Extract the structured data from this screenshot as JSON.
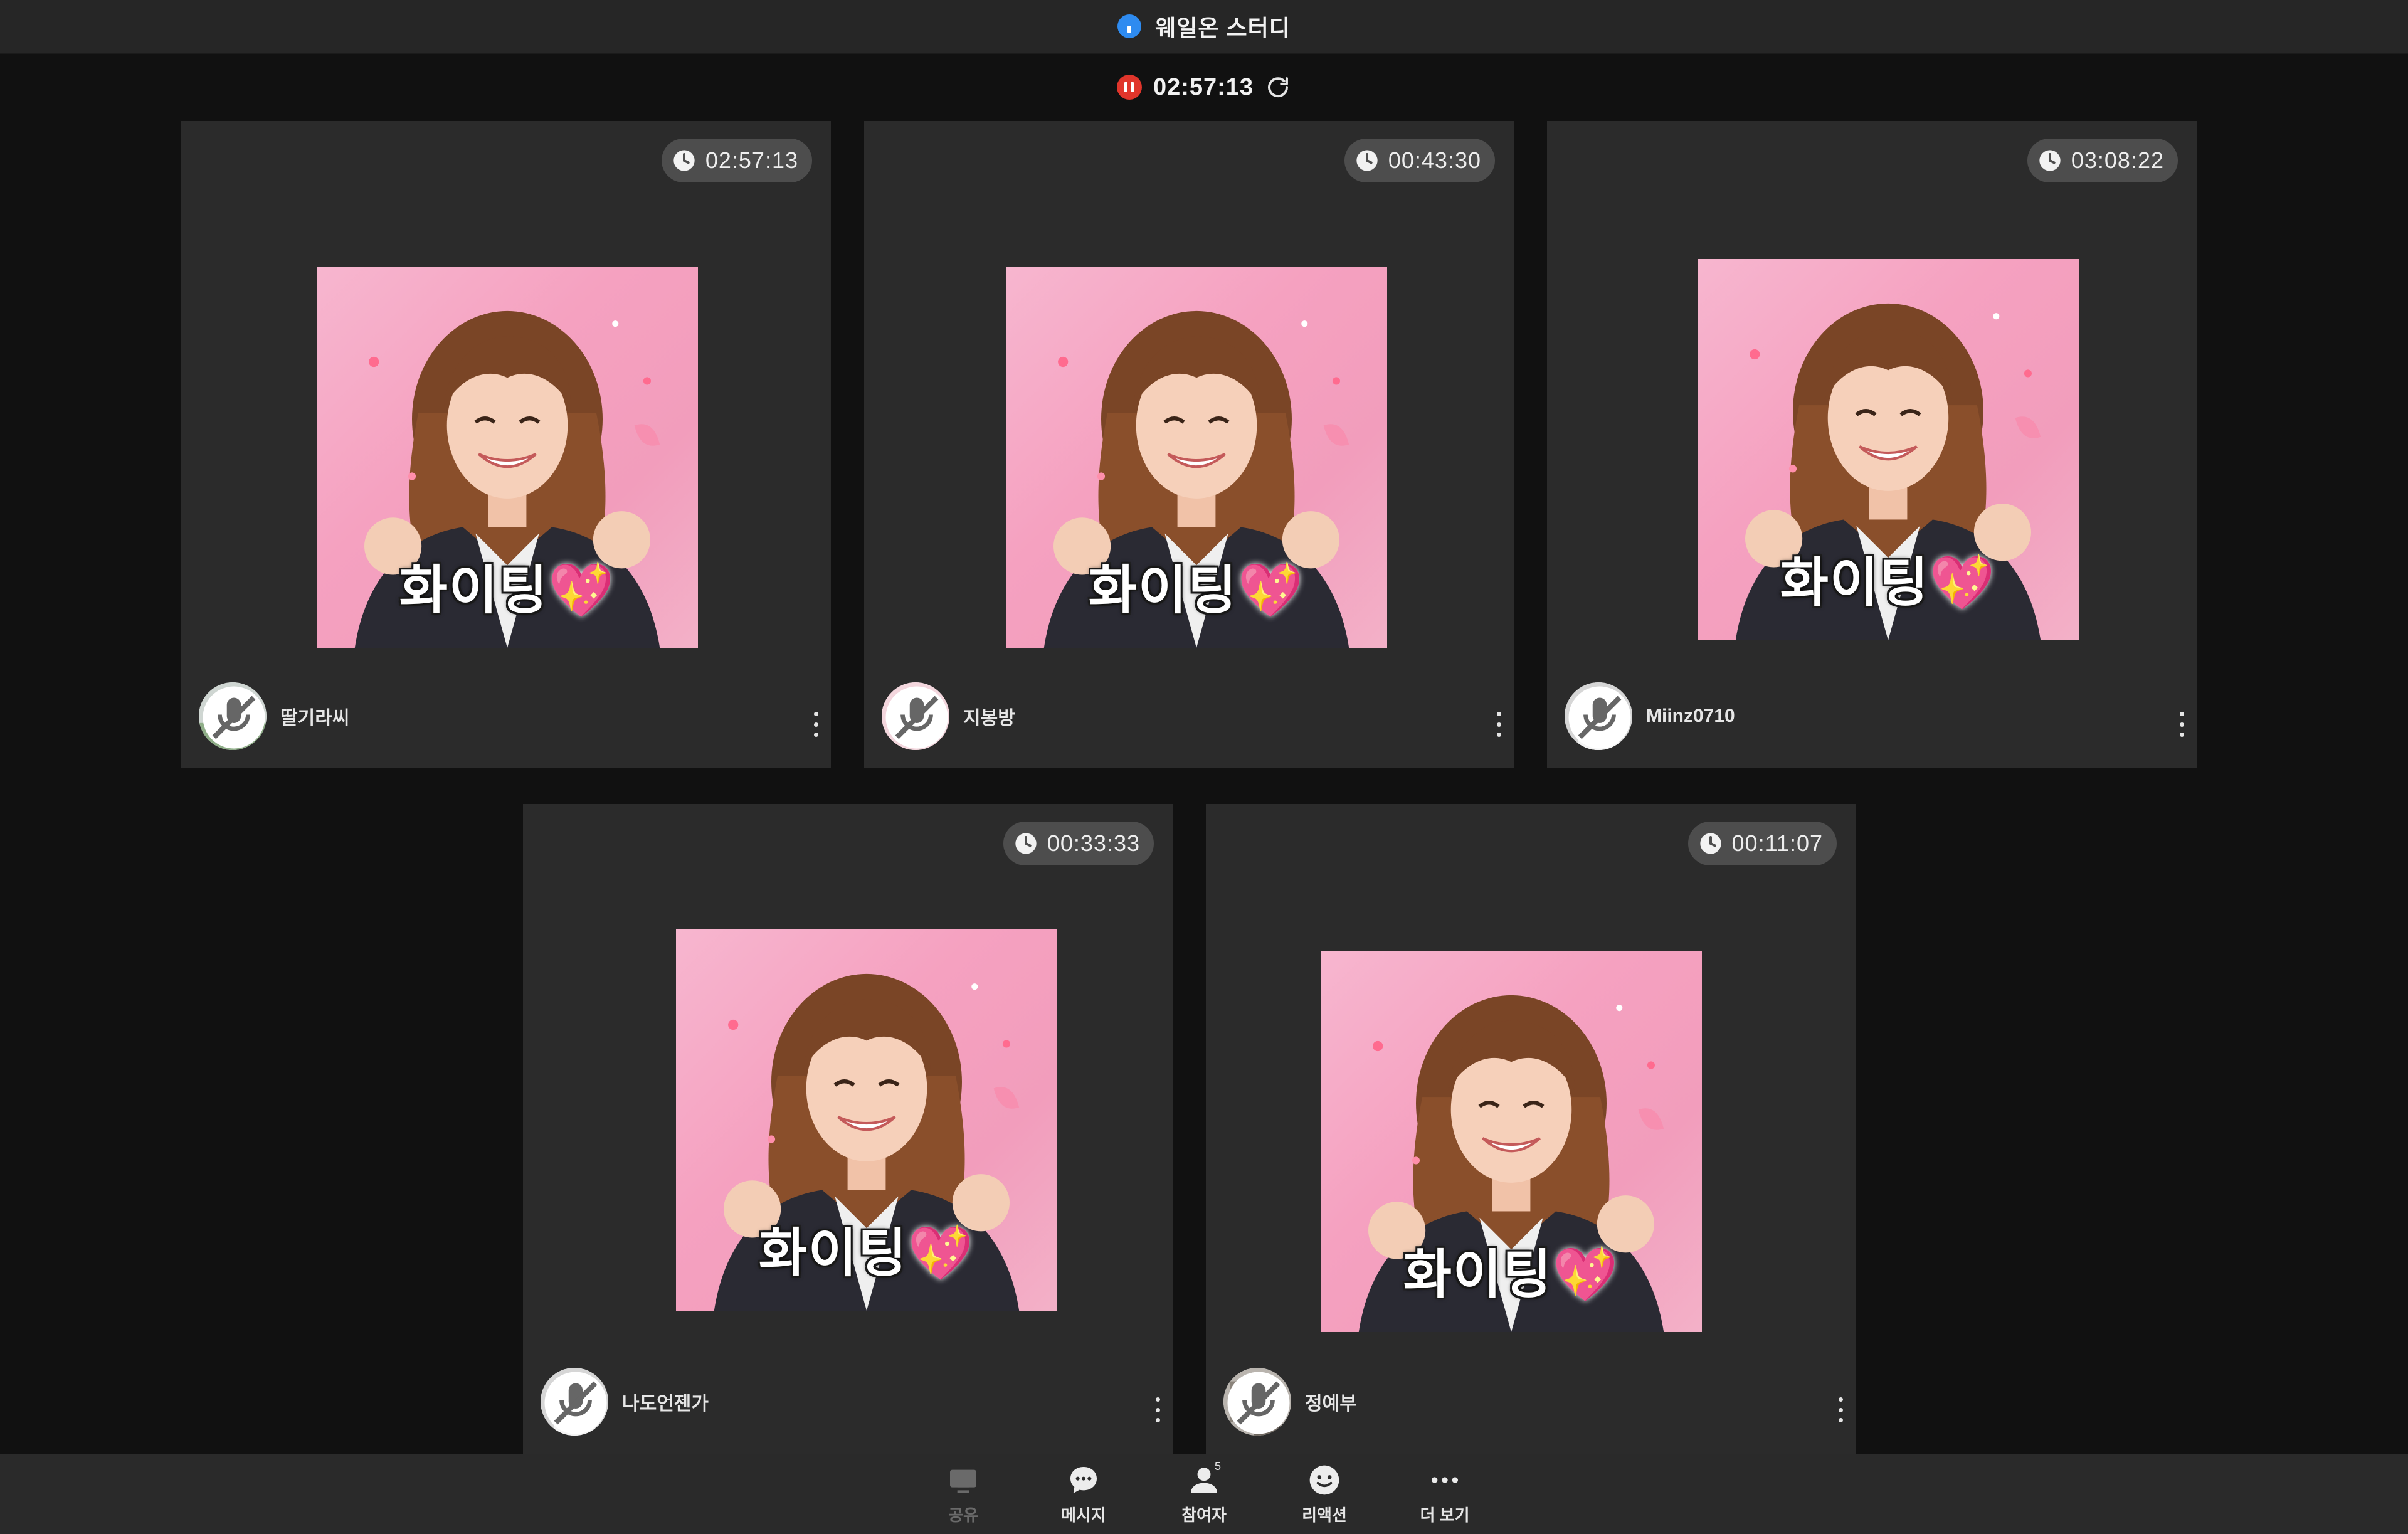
{
  "window": {
    "title": "웨일온 스터디"
  },
  "recording": {
    "elapsed": "02:57:13"
  },
  "participants": [
    {
      "name": "딸기라씨",
      "timer": "02:57:13"
    },
    {
      "name": "지봉방",
      "timer": "00:43:30"
    },
    {
      "name": "Miinz0710",
      "timer": "03:08:22"
    },
    {
      "name": "나도언젠가",
      "timer": "00:33:33"
    },
    {
      "name": "정예부",
      "timer": "00:11:07"
    }
  ],
  "video": {
    "caption": "화이팅",
    "caption_emoji": "💖"
  },
  "toolbar": {
    "share_label": "공유",
    "message_label": "메시지",
    "participants_label": "참여자",
    "participants_count": "5",
    "reaction_label": "리액션",
    "more_label": "더 보기"
  },
  "colors": {
    "background": "#111111",
    "tile": "#2b2b2b",
    "accent": "#2e8bf0",
    "record": "#e0352b"
  }
}
